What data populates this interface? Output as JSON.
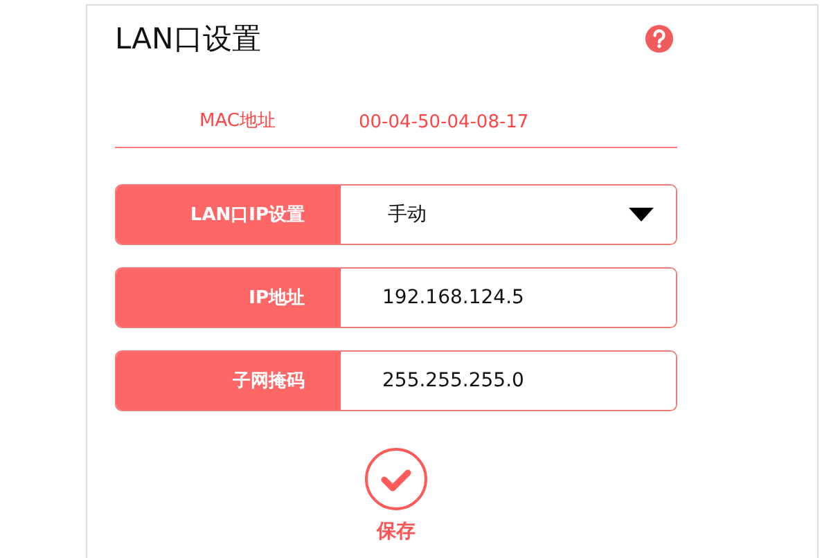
{
  "title": "LAN口设置",
  "mac": {
    "label": "MAC地址",
    "value": "00-04-50-04-08-17"
  },
  "fields": [
    {
      "kind": "select",
      "label": "LAN口IP设置",
      "value": "手动"
    },
    {
      "kind": "text",
      "label": "IP地址",
      "value": "192.168.124.5"
    },
    {
      "kind": "text",
      "label": "子网掩码",
      "value": "255.255.255.0"
    }
  ],
  "save_button": {
    "label": "保存"
  }
}
